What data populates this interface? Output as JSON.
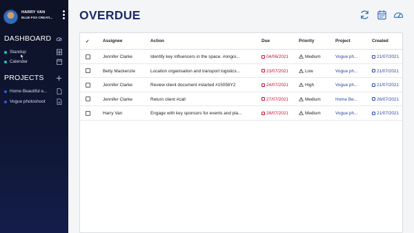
{
  "user": {
    "name": "HARRY VAN",
    "org": "BLUE FOX CREATI..."
  },
  "sidebar": {
    "dashboard": {
      "title": "DASHBOARD",
      "icon": "dashboard-gauge-icon",
      "items": [
        {
          "label": "Standup",
          "dot": "#27c2c7",
          "icon": "table-icon"
        },
        {
          "label": "Calendar",
          "dot": "#27c2c7",
          "icon": "calendar-icon"
        }
      ]
    },
    "projects": {
      "title": "PROJECTS",
      "icon": "plus-icon",
      "items": [
        {
          "label": "Home Beautiful e...",
          "dot": "#2d5bd8",
          "icon": "file-icon"
        },
        {
          "label": "Vogue photoshoot",
          "dot": "#2d5bd8",
          "icon": "file-icon"
        }
      ]
    }
  },
  "header": {
    "title": "OVERDUE",
    "icons": [
      "refresh-icon",
      "calendar-icon",
      "dashboard-gauge-icon"
    ]
  },
  "table": {
    "columns": {
      "check": "✓",
      "assignee": "Assignee",
      "action": "Action",
      "due": "Due",
      "priority": "Priority",
      "project": "Project",
      "created": "Created"
    },
    "rows": [
      {
        "assignee": "Jennifer Clarke",
        "action": "Identify key influencers in the space. #ongoi...",
        "due": "04/06/2021",
        "priority": "Medium",
        "project": "Vogue ph...",
        "created": "21/07/2021"
      },
      {
        "assignee": "Betty Mackenzie",
        "action": "Location organisation and transport logistics...",
        "due": "23/07/2021",
        "priority": "Low",
        "project": "Vogue ph...",
        "created": "21/07/2021"
      },
      {
        "assignee": "Jennifer Clarke",
        "action": "Review client document #started #15058Y2",
        "due": "24/07/2021",
        "priority": "High",
        "project": "Vogue ph...",
        "created": "21/07/2021"
      },
      {
        "assignee": "Jennifer Clarke",
        "action": "Return client #call",
        "due": "27/07/2021",
        "priority": "Medium",
        "project": "Home Be...",
        "created": "26/07/2021"
      },
      {
        "assignee": "Harry Van",
        "action": "Engage with key sponsors for events and pla...",
        "due": "28/07/2021",
        "priority": "Medium",
        "project": "Vogue ph...",
        "created": "21/07/2021"
      }
    ]
  },
  "colors": {
    "title": "#1d2a6b",
    "due": "#c8102e",
    "link": "#2747a3",
    "icon": "#2b6fc2"
  }
}
